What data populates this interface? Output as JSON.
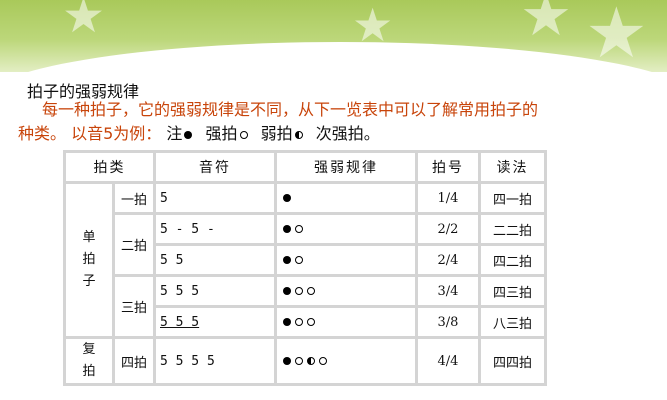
{
  "slide": {
    "title": "拍子的强弱规律",
    "para_line1": "每一种拍子，它的强弱规律是不同，从下一览表中可以了解常用拍子的",
    "para_line2_prefix": "种类。 以音5为例：",
    "legend": [
      {
        "label": "注",
        "symbol": "strong"
      },
      {
        "label": "强拍",
        "symbol": "weak"
      },
      {
        "label": "弱拍",
        "symbol": "sub"
      },
      {
        "label": "次强拍。",
        "symbol": ""
      }
    ]
  },
  "table": {
    "headers": [
      "拍类",
      "音符",
      "强弱规律",
      "拍号",
      "读法"
    ],
    "groups": [
      {
        "label": "单拍子",
        "chars": [
          "单",
          "拍",
          "子"
        ]
      },
      {
        "label": "复拍",
        "chars": [
          "复",
          "拍"
        ]
      }
    ],
    "rows": [
      {
        "sub": "一拍",
        "notes": "5",
        "pattern": [
          "strong"
        ],
        "meter": "1/4",
        "read": "四一拍"
      },
      {
        "sub": "二拍",
        "notes": "5 - 5 -",
        "pattern": [
          "strong",
          "weak"
        ],
        "meter": "2/2",
        "read": "二二拍"
      },
      {
        "sub": "",
        "notes": "5 5",
        "pattern": [
          "strong",
          "weak"
        ],
        "meter": "2/4",
        "read": "四二拍"
      },
      {
        "sub": "三拍",
        "notes": "5 5 5",
        "pattern": [
          "strong",
          "weak",
          "weak"
        ],
        "meter": "3/4",
        "read": "四三拍"
      },
      {
        "sub": "",
        "notes": "5 5 5",
        "notes_underlined": true,
        "pattern": [
          "strong",
          "weak",
          "weak"
        ],
        "meter": "3/8",
        "read": "八三拍"
      },
      {
        "sub": "四拍",
        "notes": "5 5 5 5",
        "pattern": [
          "strong",
          "weak",
          "sub",
          "weak"
        ],
        "meter": "4/4",
        "read": "四四拍"
      }
    ]
  },
  "colors": {
    "banner": "#a9c95a",
    "accent_text": "#c8440a"
  }
}
